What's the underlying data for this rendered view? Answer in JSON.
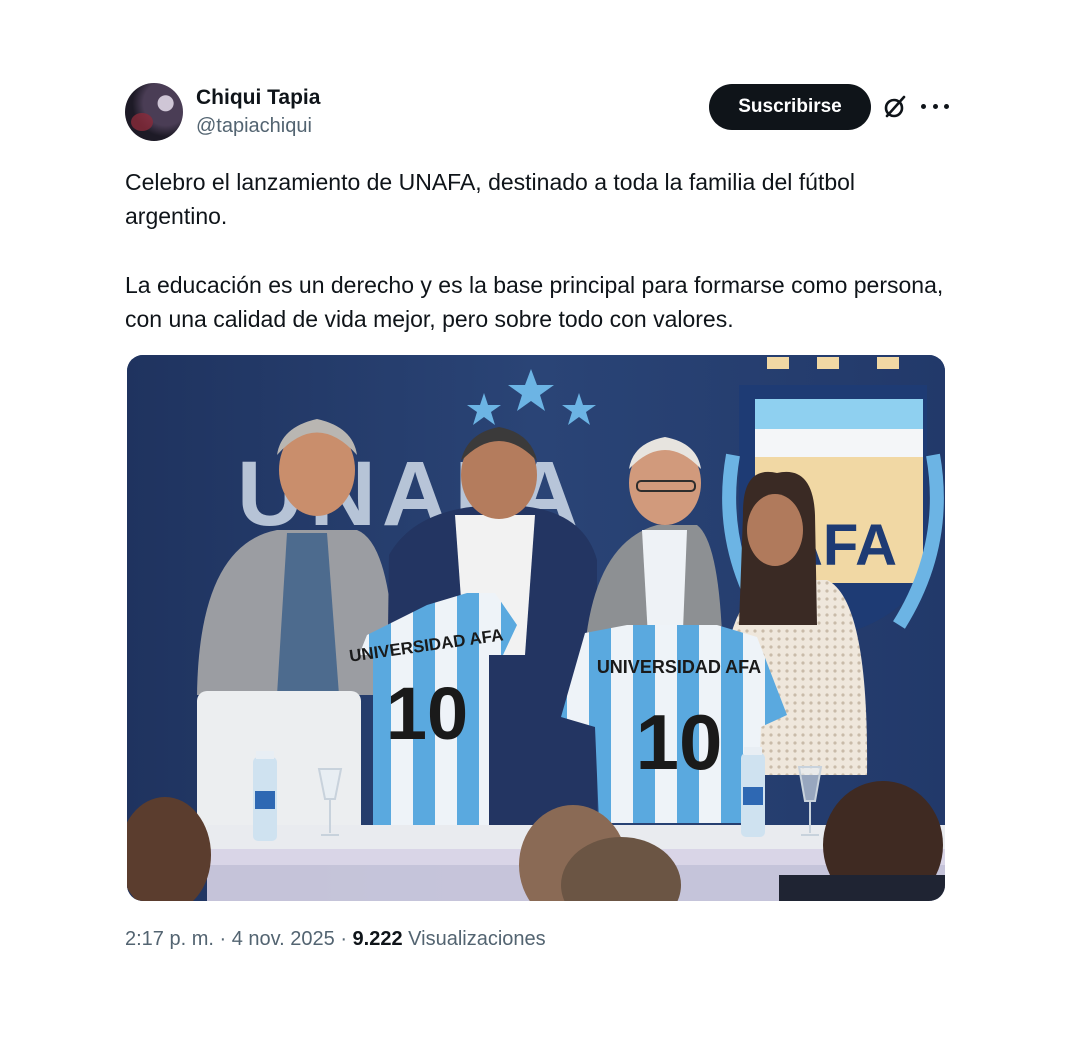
{
  "author": {
    "name": "Chiqui Tapia",
    "handle": "@tapiachiqui"
  },
  "actions": {
    "subscribe_label": "Suscribirse"
  },
  "tweet": {
    "paragraph_1": "Celebro el lanzamiento de UNAFA, destinado a toda la familia del fútbol argentino.",
    "paragraph_2": "La educación es un derecho y es la base principal para formarse como persona, con una calidad de vida mejor, pero sobre todo con valores."
  },
  "photo": {
    "backdrop_text_left": "UNAFA",
    "crest_text": "AFA",
    "jersey_left": {
      "text": "UNIVERSIDAD AFA",
      "number": "10"
    },
    "jersey_right": {
      "text": "UNIVERSIDAD AFA",
      "number": "10"
    }
  },
  "meta": {
    "time": "2:17 p. m.",
    "date": "4 nov. 2025",
    "views_count": "9.222",
    "views_label": "Visualizaciones"
  },
  "icons": {
    "grok": "grok-icon",
    "more": "more-icon"
  },
  "colors": {
    "text": "#0f1419",
    "secondary": "#536471",
    "button_bg": "#0f1419",
    "backdrop": "#243a69",
    "celeste": "#6cb4e4"
  }
}
